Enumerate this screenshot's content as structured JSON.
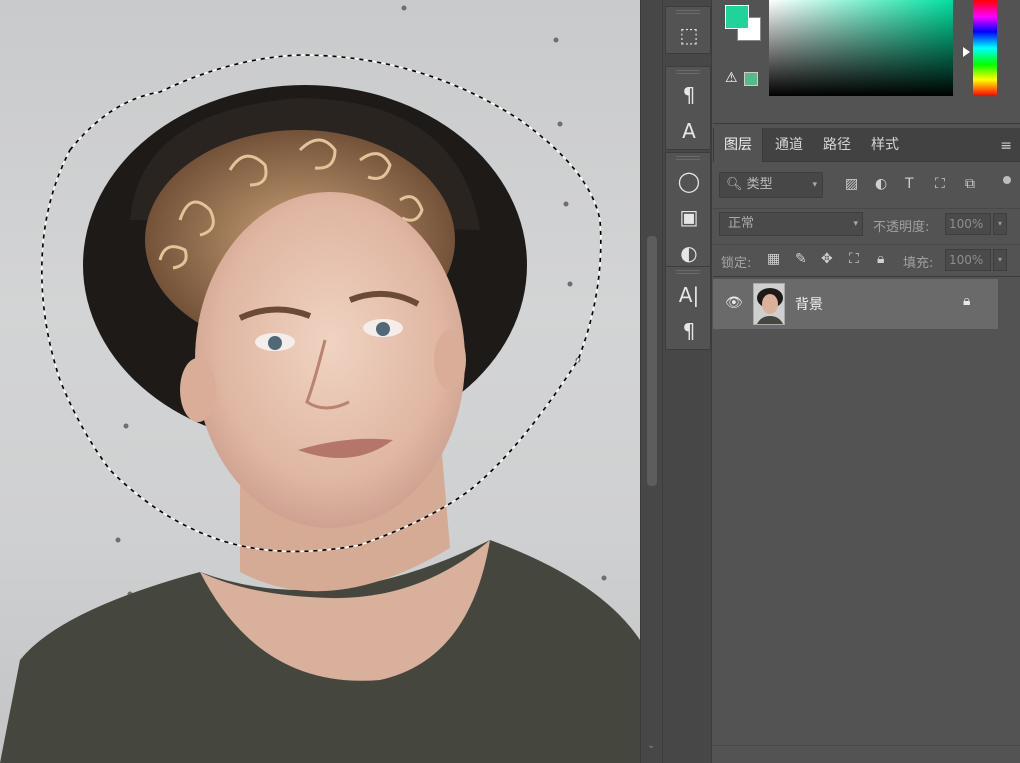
{
  "colors": {
    "foreground": "#1fd49b",
    "background": "#ffffff",
    "gamut_warning": "#58b98d",
    "saturation_hue": "#00e0a0"
  },
  "toolbar": {
    "groups": [
      {
        "tools": [
          {
            "name": "3d-object-icon",
            "glyph": "⬚"
          }
        ]
      },
      {
        "tools": [
          {
            "name": "paragraph-styles-icon",
            "glyph": "¶"
          },
          {
            "name": "character-styles-icon",
            "glyph": "A"
          }
        ]
      },
      {
        "tools": [
          {
            "name": "lightbulb-icon",
            "glyph": "◯"
          },
          {
            "name": "properties-icon",
            "glyph": "▣"
          },
          {
            "name": "adjustments-icon",
            "glyph": "◐"
          }
        ]
      },
      {
        "tools": [
          {
            "name": "character-icon",
            "glyph": "A|"
          },
          {
            "name": "paragraph-icon",
            "glyph": "¶"
          }
        ]
      }
    ]
  },
  "layers_panel": {
    "tabs": [
      {
        "id": "layers",
        "label": "图层",
        "active": true
      },
      {
        "id": "channels",
        "label": "通道",
        "active": false
      },
      {
        "id": "paths",
        "label": "路径",
        "active": false
      },
      {
        "id": "styles",
        "label": "样式",
        "active": false
      }
    ],
    "menu_icon": "≡",
    "filter": {
      "type_label": "类型"
    },
    "blend_mode": "正常",
    "opacity_label": "不透明度:",
    "opacity_value": "100%",
    "lock_label": "锁定:",
    "fill_label": "填充:",
    "fill_value": "100%",
    "layers": [
      {
        "name": "背景",
        "visible": true,
        "locked": true
      }
    ]
  }
}
